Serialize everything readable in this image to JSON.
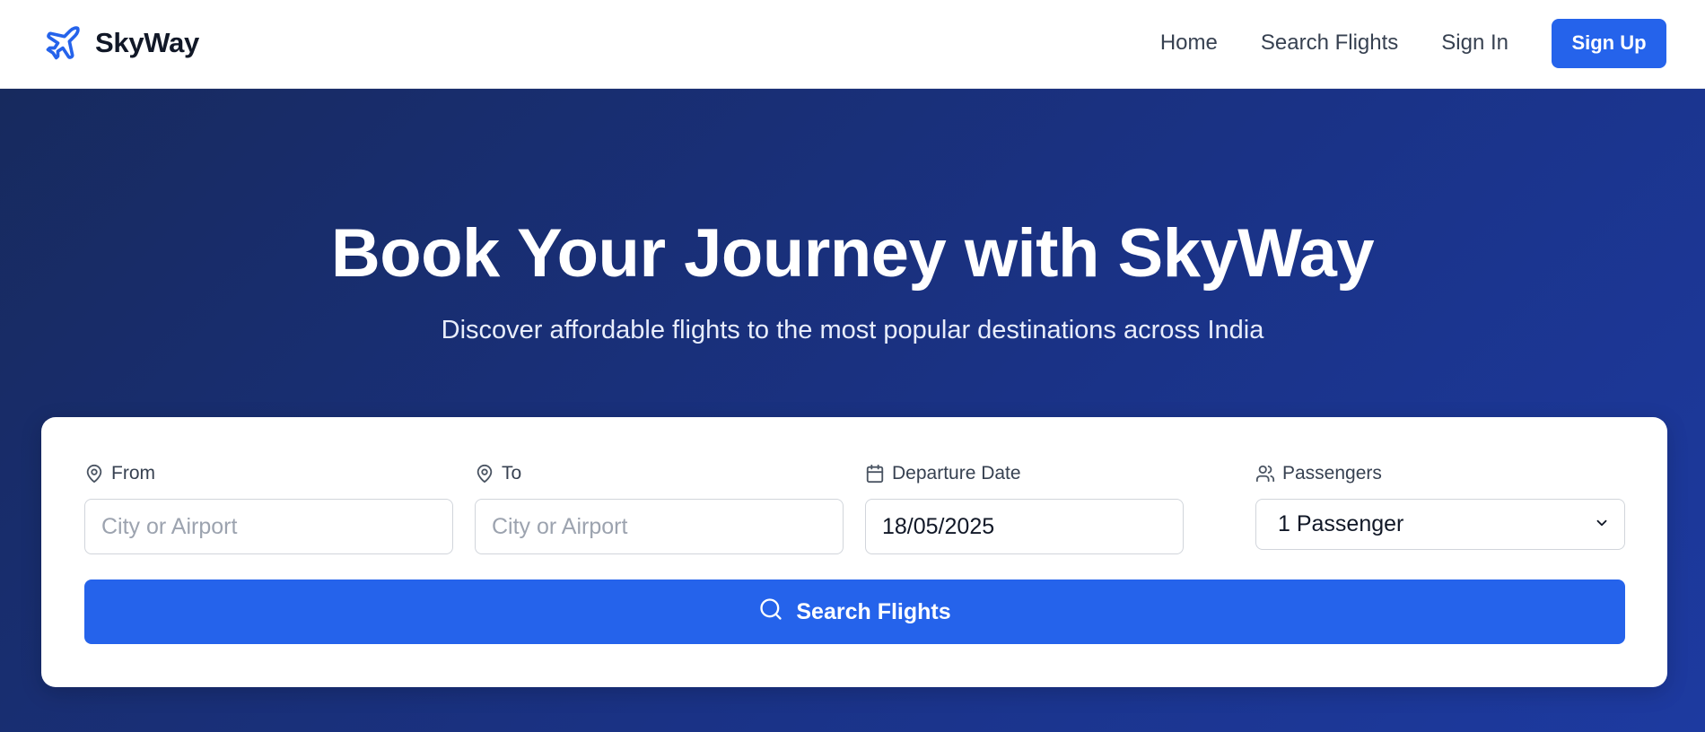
{
  "brand": {
    "name": "SkyWay",
    "icon": "plane-icon",
    "color": "#2563eb"
  },
  "nav": {
    "links": [
      "Home",
      "Search Flights",
      "Sign In"
    ],
    "signup_label": "Sign Up"
  },
  "hero": {
    "title": "Book Your Journey with SkyWay",
    "subtitle": "Discover affordable flights to the most popular destinations across India"
  },
  "search": {
    "from": {
      "label": "From",
      "icon": "map-pin-icon",
      "placeholder": "City or Airport",
      "value": ""
    },
    "to": {
      "label": "To",
      "icon": "map-pin-icon",
      "placeholder": "City or Airport",
      "value": ""
    },
    "date": {
      "label": "Departure Date",
      "icon": "calendar-icon",
      "value": "18/05/2025"
    },
    "passengers": {
      "label": "Passengers",
      "icon": "users-icon",
      "selected": "1 Passenger"
    },
    "button_label": "Search Flights",
    "button_icon": "search-icon"
  },
  "colors": {
    "primary": "#2563eb",
    "hero_bg_start": "#172a5e",
    "hero_bg_end": "#1d3aa0"
  }
}
